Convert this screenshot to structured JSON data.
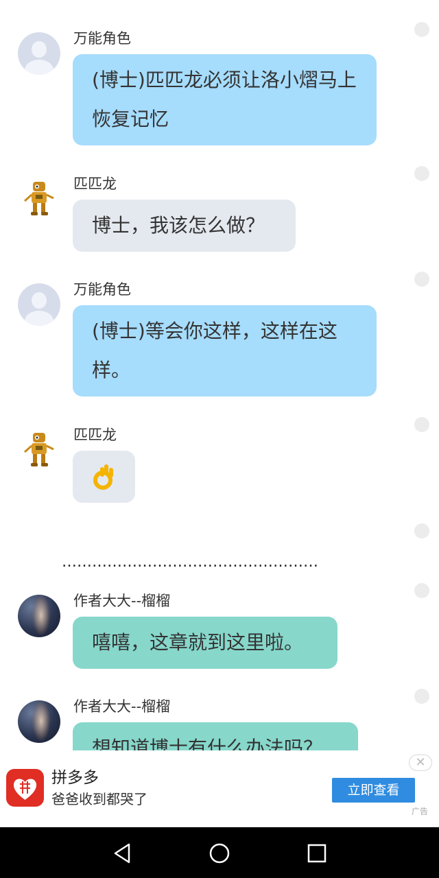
{
  "messages": [
    {
      "sender": "万能角色",
      "text": "(博士)匹匹龙必须让洛小熠马上恢复记忆"
    },
    {
      "sender": "匹匹龙",
      "text": "博士，我该怎么做？"
    },
    {
      "sender": "万能角色",
      "text": "(博士)等会你这样，这样在这样。"
    },
    {
      "sender": "匹匹龙",
      "emoji": "👌"
    },
    {
      "divider": "……………………………………………"
    },
    {
      "sender": "作者大大--榴榴",
      "text": "嘻嘻，这章就到这里啦。"
    },
    {
      "sender": "作者大大--榴榴",
      "text": "想知道博士有什么办法吗？"
    }
  ],
  "ad": {
    "app_name": "拼多多",
    "slogan": "爸爸收到都哭了",
    "button_label": "立即查看",
    "tag": "广告",
    "close_symbol": "✕"
  },
  "colors": {
    "bubble_blue": "#a6dcfc",
    "bubble_grey": "#e4e8ef",
    "bubble_teal": "#87d7cb",
    "ad_button": "#2f8ce0",
    "pdd_red": "#e02e24"
  },
  "icons": {
    "nav_back": "back-triangle-icon",
    "nav_home": "home-circle-icon",
    "nav_recent": "recent-square-icon"
  }
}
